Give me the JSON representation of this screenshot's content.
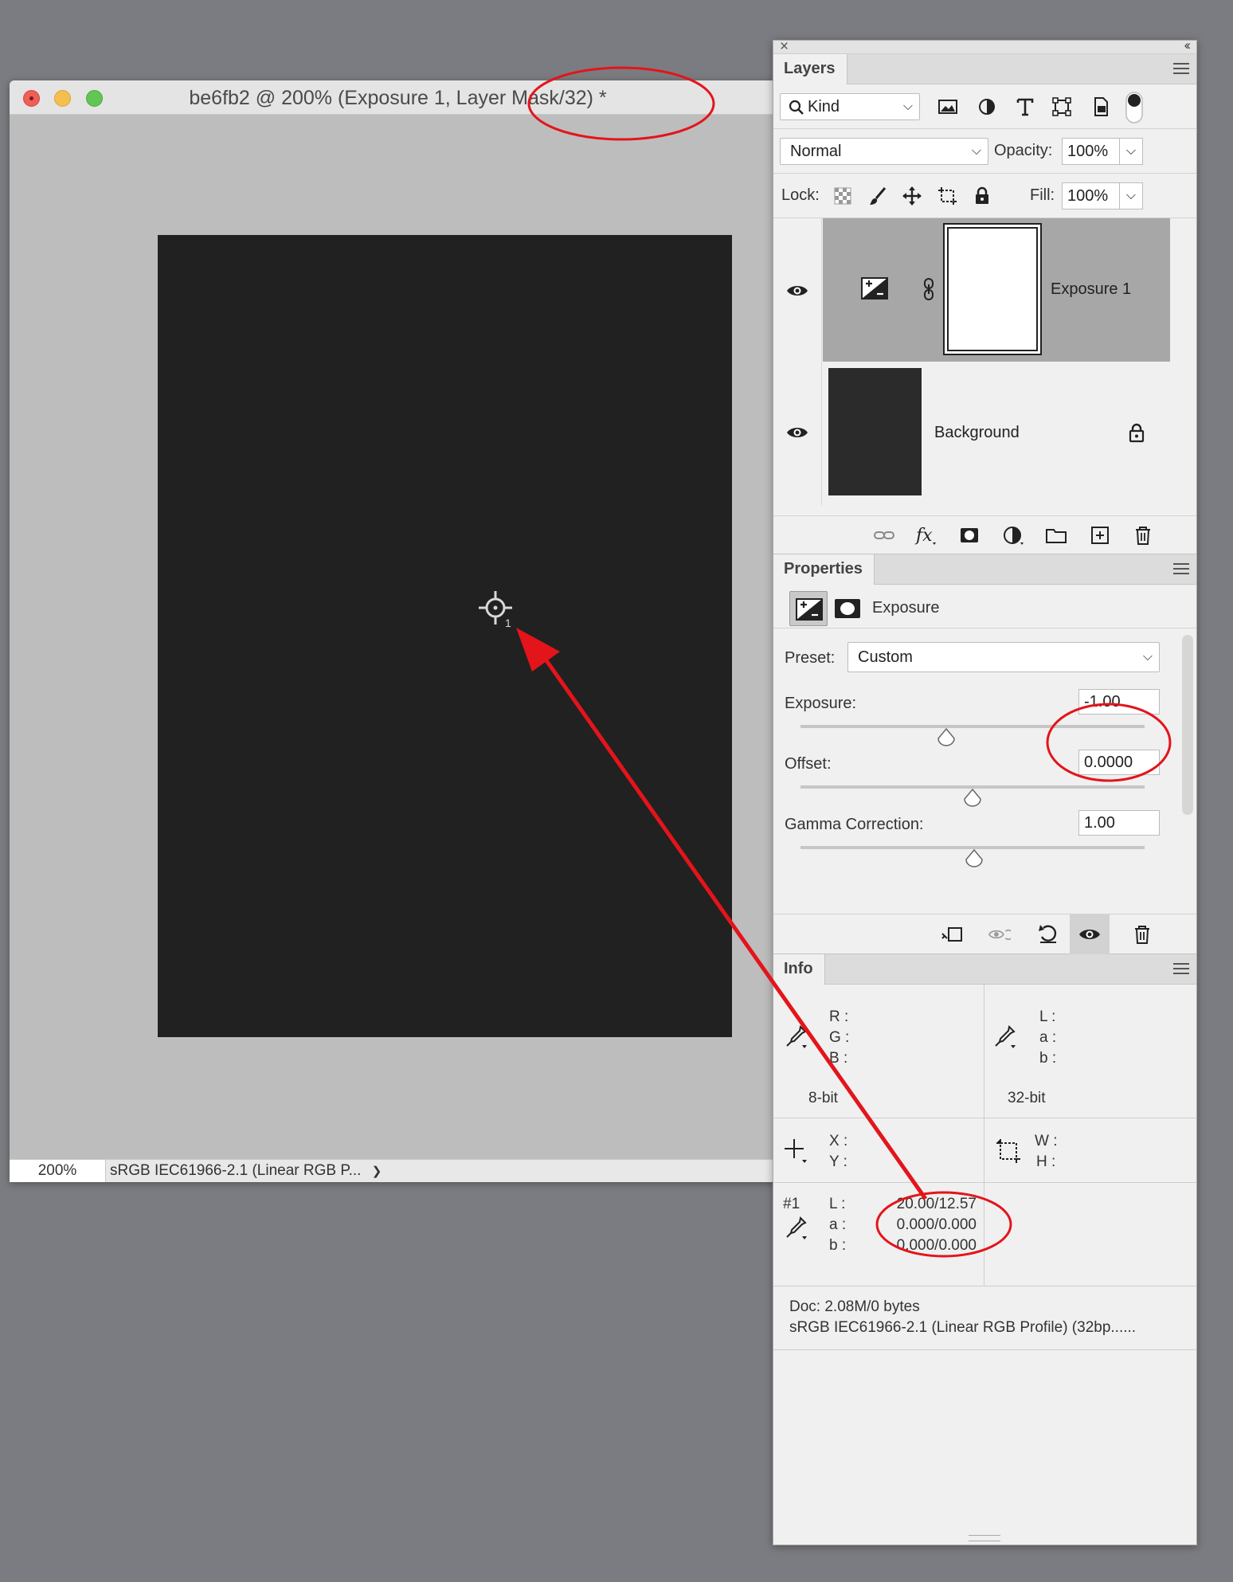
{
  "document": {
    "title": "be6fb2 @ 200% (Exposure 1, Layer Mask/32) *",
    "zoom": "200%",
    "profile": "sRGB IEC61966-2.1 (Linear RGB P...",
    "profile_arrow": "❯",
    "sampler_number": "1"
  },
  "panels": {
    "close_glyph": "×",
    "collapse_glyph": "‹‹"
  },
  "layers": {
    "tab": "Layers",
    "filter_kind": "Kind",
    "blend_mode": "Normal",
    "opacity_label": "Opacity:",
    "opacity": "100%",
    "lock_label": "Lock:",
    "fill_label": "Fill:",
    "fill": "100%",
    "items": [
      {
        "name": "Exposure 1",
        "selected": true,
        "type": "adjustment"
      },
      {
        "name": "Background",
        "selected": false,
        "locked": true,
        "type": "pixel"
      }
    ]
  },
  "properties": {
    "tab": "Properties",
    "title": "Exposure",
    "preset_label": "Preset:",
    "preset": "Custom",
    "exposure_label": "Exposure:",
    "exposure": "-1.00",
    "offset_label": "Offset:",
    "offset": "0.0000",
    "gamma_label": "Gamma Correction:",
    "gamma": "1.00"
  },
  "info": {
    "tab": "Info",
    "rgb_labels": [
      "R :",
      "G :",
      "B :"
    ],
    "lab_labels": [
      "L :",
      "a :",
      "b :"
    ],
    "bit_left": "8-bit",
    "bit_right": "32-bit",
    "xy_labels": [
      "X :",
      "Y :"
    ],
    "wh_labels": [
      "W :",
      "H :"
    ],
    "sampler_id": "#1",
    "sampler_labels": [
      "L :",
      "a :",
      "b :"
    ],
    "sampler_values": [
      "20.00/12.57",
      "0.000/0.000",
      "0.000/0.000"
    ],
    "doc_size": "Doc: 2.08M/0 bytes",
    "doc_profile": "sRGB IEC61966-2.1 (Linear RGB Profile) (32bp......"
  },
  "colors": {
    "annotation": "#e4141b",
    "canvas": "#212121",
    "selected_layer": "#a7a7a7"
  }
}
